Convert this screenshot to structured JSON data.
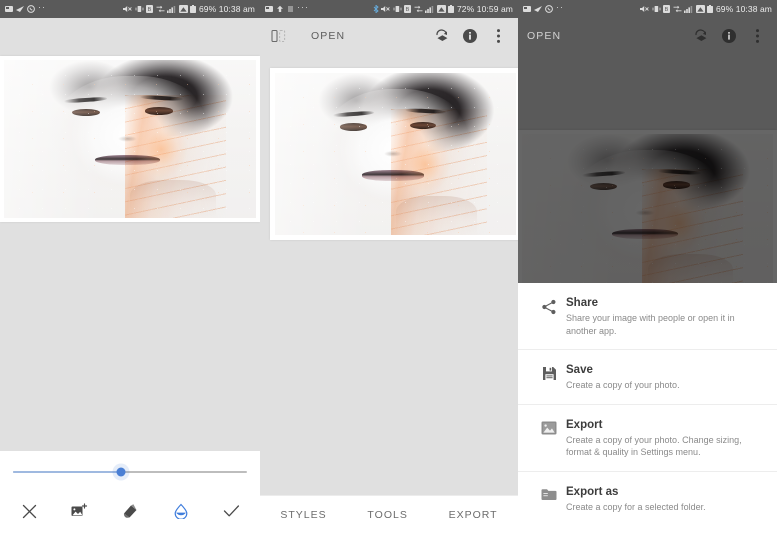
{
  "panels": {
    "left": {
      "status_bar": {
        "left_icons": [
          "sim-card-icon",
          "send-icon",
          "whatsapp-icon",
          "more-dots-icon"
        ],
        "right_icons": [
          "volume-mute-icon",
          "vibrate-icon",
          "sd-card-icon",
          "sync-icon",
          "signal-icon",
          "signal-two-icon",
          "battery-icon"
        ],
        "battery": "69%",
        "time": "10:38 am"
      },
      "toolbar": {
        "title": "",
        "icons": []
      },
      "editor": {
        "slider": {
          "value": 46,
          "fill_color": "#9fb9e0",
          "thumb_color": "#4a7fd4",
          "track_color": "#bdbdbd"
        },
        "tools": [
          {
            "name": "cancel-icon",
            "label": "Cancel",
            "active": false
          },
          {
            "name": "add-image-icon",
            "label": "Add image",
            "active": false
          },
          {
            "name": "layers-icon",
            "label": "Blend",
            "active": false
          },
          {
            "name": "water-drop-icon",
            "label": "Adjust",
            "active": true,
            "color": "#3f7ddc"
          },
          {
            "name": "confirm-check-icon",
            "label": "Apply",
            "active": false
          }
        ]
      }
    },
    "middle": {
      "status_bar": {
        "left_icons": [
          "sim-card-icon",
          "upload-icon",
          "app-icon",
          "more-dots-icon"
        ],
        "right_icons": [
          "bluetooth-icon",
          "volume-mute-icon",
          "vibrate-icon",
          "sd-card-icon",
          "sync-icon",
          "signal-icon",
          "signal-two-icon",
          "battery-icon"
        ],
        "battery": "72%",
        "time": "10:59 am"
      },
      "toolbar": {
        "compare_icon": "compare-split-icon",
        "title": "OPEN",
        "undo_icon": "history-undo-icon",
        "info_icon": "info-icon",
        "overflow_icon": "overflow-menu-icon"
      },
      "tabs": [
        {
          "label": "STYLES",
          "name": "tab-styles"
        },
        {
          "label": "TOOLS",
          "name": "tab-tools"
        },
        {
          "label": "EXPORT",
          "name": "tab-export"
        }
      ]
    },
    "right": {
      "status_bar": {
        "left_icons": [
          "sim-card-icon",
          "send-icon",
          "whatsapp-icon",
          "more-dots-icon"
        ],
        "right_icons": [
          "volume-mute-icon",
          "vibrate-icon",
          "sd-card-icon",
          "sync-icon",
          "signal-icon",
          "signal-two-icon",
          "battery-icon"
        ],
        "battery": "69%",
        "time": "10:38 am"
      },
      "toolbar": {
        "title": "OPEN",
        "undo_icon": "history-undo-icon",
        "info_icon": "info-icon",
        "overflow_icon": "overflow-menu-icon"
      },
      "sheet": {
        "items": [
          {
            "icon": "share-icon",
            "title": "Share",
            "subtitle": "Share your image with people or open it in another app."
          },
          {
            "icon": "save-disk-icon",
            "title": "Save",
            "subtitle": "Create a copy of your photo."
          },
          {
            "icon": "export-image-icon",
            "title": "Export",
            "subtitle": "Create a copy of your photo. Change sizing, format & quality in Settings menu."
          },
          {
            "icon": "folder-icon",
            "title": "Export as",
            "subtitle": "Create a copy for a selected folder."
          }
        ]
      }
    }
  },
  "colors": {
    "status_bar_bg": "#5a5a5a",
    "canvas_bg": "#e0e0e0",
    "sheet_bg": "#ffffff",
    "scrim": "rgba(0,0,0,0.60)",
    "accent": "#3f7ddc",
    "title_text": "#5d5d5d",
    "body_text": "#3c3c3c",
    "muted_text": "#8a8a8a"
  }
}
